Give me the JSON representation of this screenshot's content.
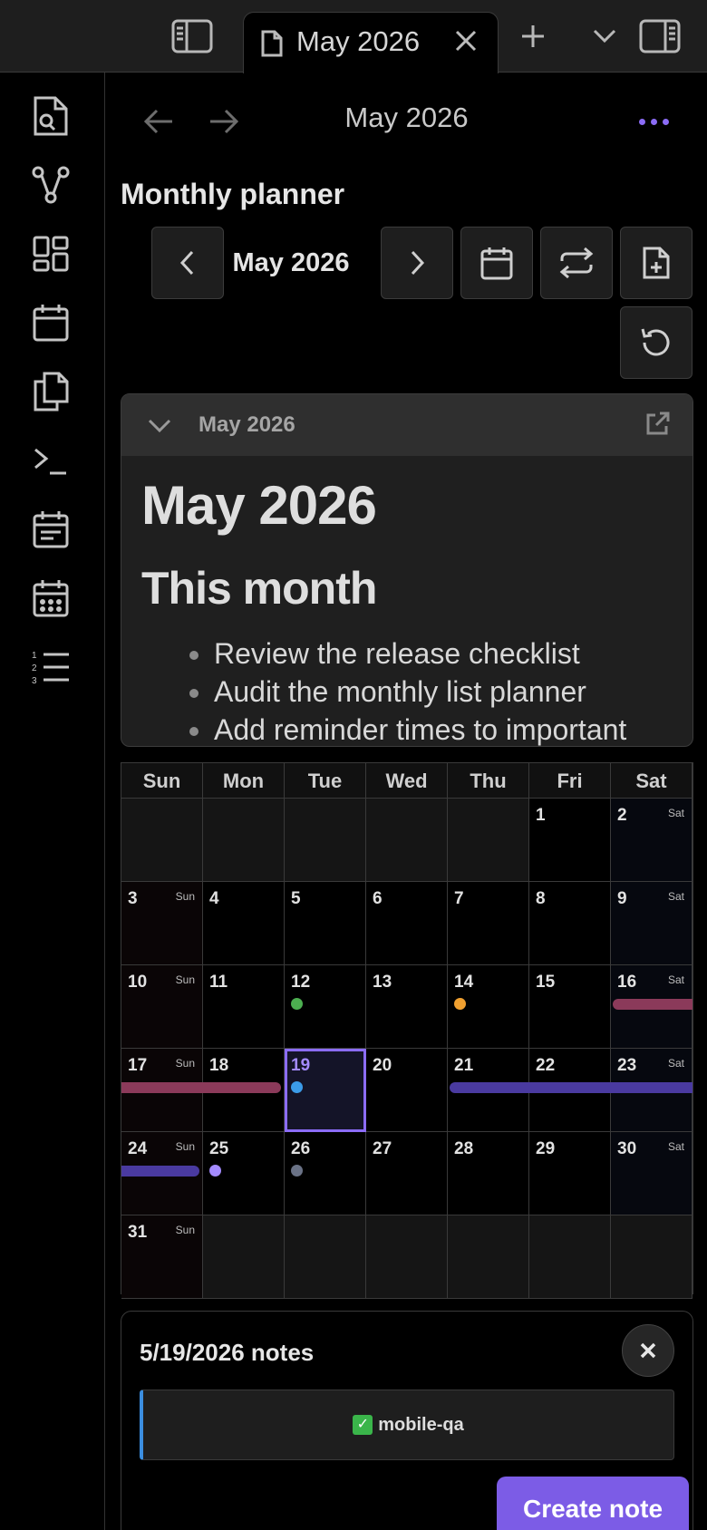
{
  "tab": {
    "title": "May 2026"
  },
  "header": {
    "title": "May 2026"
  },
  "planner": {
    "title": "Monthly planner",
    "month_label": "May 2026"
  },
  "embed": {
    "name": "May 2026",
    "heading1": "May 2026",
    "heading2": "This month",
    "items": [
      "Review the release checklist",
      "Audit the monthly list planner",
      "Add reminder times to important"
    ]
  },
  "calendar": {
    "weekdays": [
      "Sun",
      "Mon",
      "Tue",
      "Wed",
      "Thu",
      "Fri",
      "Sat"
    ],
    "sun_tag": "Sun",
    "sat_tag": "Sat",
    "today": 19,
    "colors": {
      "green": "#4caf50",
      "orange": "#f0a030",
      "blue": "#3b9be8",
      "lavender": "#a48bff",
      "slate": "#6a7286",
      "pink_bar": "#8b3a5a",
      "purple_bar": "#4a3aa0",
      "accent": "#8b6cf6"
    }
  },
  "notes": {
    "title": "5/19/2026 notes",
    "item": "mobile-qa",
    "create_label": "Create note"
  }
}
